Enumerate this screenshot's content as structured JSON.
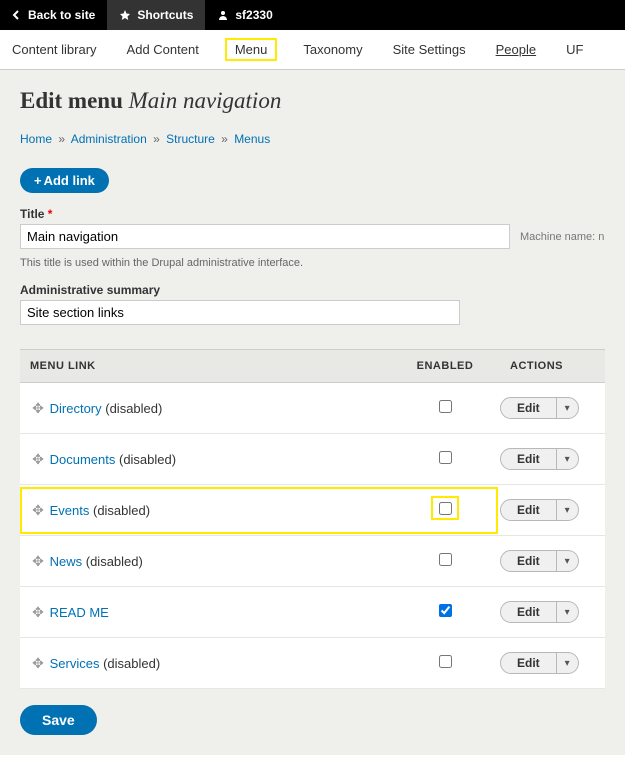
{
  "topbar": {
    "back_label": "Back to site",
    "shortcuts_label": "Shortcuts",
    "user_label": "sf2330"
  },
  "tabs": {
    "content_library": "Content library",
    "add_content": "Add Content",
    "menu": "Menu",
    "taxonomy": "Taxonomy",
    "site_settings": "Site Settings",
    "people": "People",
    "updates": "UF"
  },
  "page_title_prefix": "Edit menu ",
  "page_title_name": "Main navigation",
  "breadcrumbs": {
    "home": "Home",
    "admin": "Administration",
    "structure": "Structure",
    "menus": "Menus",
    "sep": "»"
  },
  "buttons": {
    "add_link": "Add link",
    "save": "Save",
    "edit": "Edit"
  },
  "form": {
    "title_label": "Title",
    "title_value": "Main navigation",
    "machine_name": "Machine name: n",
    "title_desc": "This title is used within the Drupal administrative interface.",
    "summary_label": "Administrative summary",
    "summary_value": "Site section links"
  },
  "table": {
    "headers": {
      "link": "MENU LINK",
      "enabled": "ENABLED",
      "actions": "ACTIONS"
    },
    "disabled_suffix": " (disabled)",
    "rows": [
      {
        "name": "Directory",
        "disabled": true,
        "checked": false,
        "highlight": false
      },
      {
        "name": "Documents",
        "disabled": true,
        "checked": false,
        "highlight": false
      },
      {
        "name": "Events",
        "disabled": true,
        "checked": false,
        "highlight": true
      },
      {
        "name": "News",
        "disabled": true,
        "checked": false,
        "highlight": false
      },
      {
        "name": "READ ME",
        "disabled": false,
        "checked": true,
        "highlight": false
      },
      {
        "name": "Services",
        "disabled": true,
        "checked": false,
        "highlight": false
      }
    ]
  }
}
